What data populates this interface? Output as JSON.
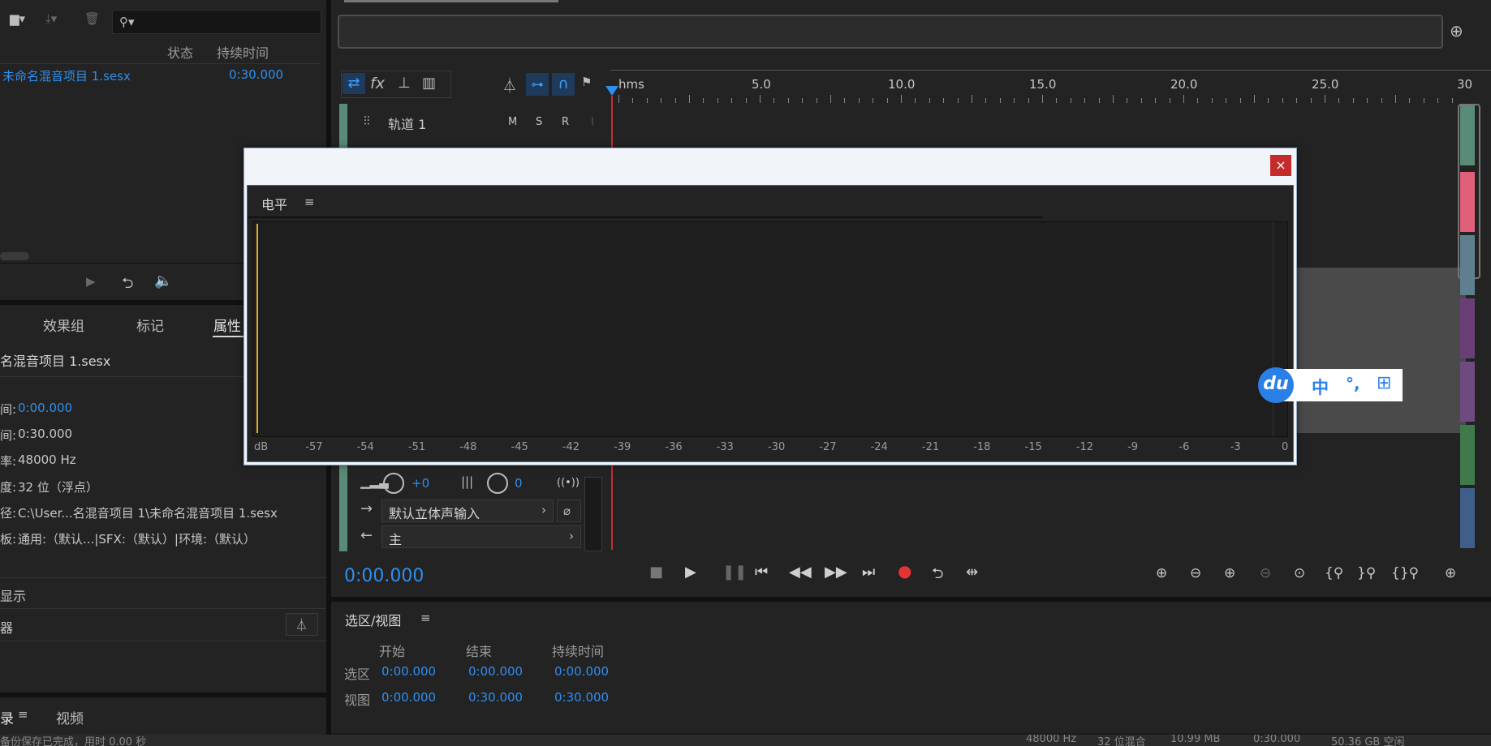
{
  "files_panel": {
    "col_status": "状态",
    "col_duration": "持续时间",
    "file_name": "未命名混音项目 1.sesx",
    "file_duration": "0:30.000"
  },
  "props_panel": {
    "tabs": [
      "效果组",
      "标记",
      "属性"
    ],
    "project_name": "名混音项目 1.sesx",
    "rows": [
      {
        "label": "间:",
        "value": "0:00.000",
        "blue": true
      },
      {
        "label": "间:",
        "value": "0:30.000",
        "blue": false
      },
      {
        "label": "率:",
        "value": "48000 Hz",
        "blue": false
      },
      {
        "label": "度:",
        "value": "32 位（浮点）",
        "blue": false
      },
      {
        "label": "径:",
        "value": "C:\\User...名混音项目 1\\未命名混音项目 1.sesx",
        "blue": false
      },
      {
        "label": "板:",
        "value": "通用:（默认...|SFX:（默认）|环境:（默认）",
        "blue": false
      }
    ],
    "section1": "显示",
    "section2": "器"
  },
  "bottom_left": {
    "tab1": "录",
    "tab2": "视频",
    "status": "备份保存已完成，用时 0.00 秒"
  },
  "timeline": {
    "ruler_labels": [
      "hms",
      "5.0",
      "10.0",
      "15.0",
      "20.0",
      "25.0",
      "30"
    ],
    "track_name": "轨道 1",
    "track_buttons": [
      "M",
      "S",
      "R",
      "I"
    ],
    "vol_value": "+0",
    "pan_value": "0",
    "input_label": "默认立体声输入",
    "output_label": "主",
    "accent": "#2e8ef0",
    "playhead_color": "#e0312f"
  },
  "transport": {
    "time": "0:00.000",
    "record_color": "#e63232"
  },
  "selection_panel": {
    "title": "选区/视图",
    "col_start": "开始",
    "col_end": "结束",
    "col_duration": "持续时间",
    "row1_label": "选区",
    "row1": [
      "0:00.000",
      "0:00.000",
      "0:00.000"
    ],
    "row2_label": "视图",
    "row2": [
      "0:00.000",
      "0:30.000",
      "0:30.000"
    ]
  },
  "levels_dialog": {
    "close": "×",
    "title": "电平",
    "db_labels": [
      "dB",
      "-57",
      "-54",
      "-51",
      "-48",
      "-45",
      "-42",
      "-39",
      "-36",
      "-33",
      "-30",
      "-27",
      "-24",
      "-21",
      "-18",
      "-15",
      "-12",
      "-9",
      "-6",
      "-3",
      "0"
    ]
  },
  "ime_toolbar": {
    "logo": "du",
    "mode": "中",
    "punct": "°,",
    "grid": "⊞"
  },
  "status_bar": {
    "items": [
      "48000 Hz",
      "32 位混合",
      "10.99 MB",
      "0:30.000",
      "50.36 GB 空闲"
    ]
  },
  "track_colors": [
    "#5a8a78",
    "#e0607a",
    "#5f7f8f",
    "#6a3f78",
    "#6f4a80",
    "#3f7a4a",
    "#3f5f8a"
  ]
}
